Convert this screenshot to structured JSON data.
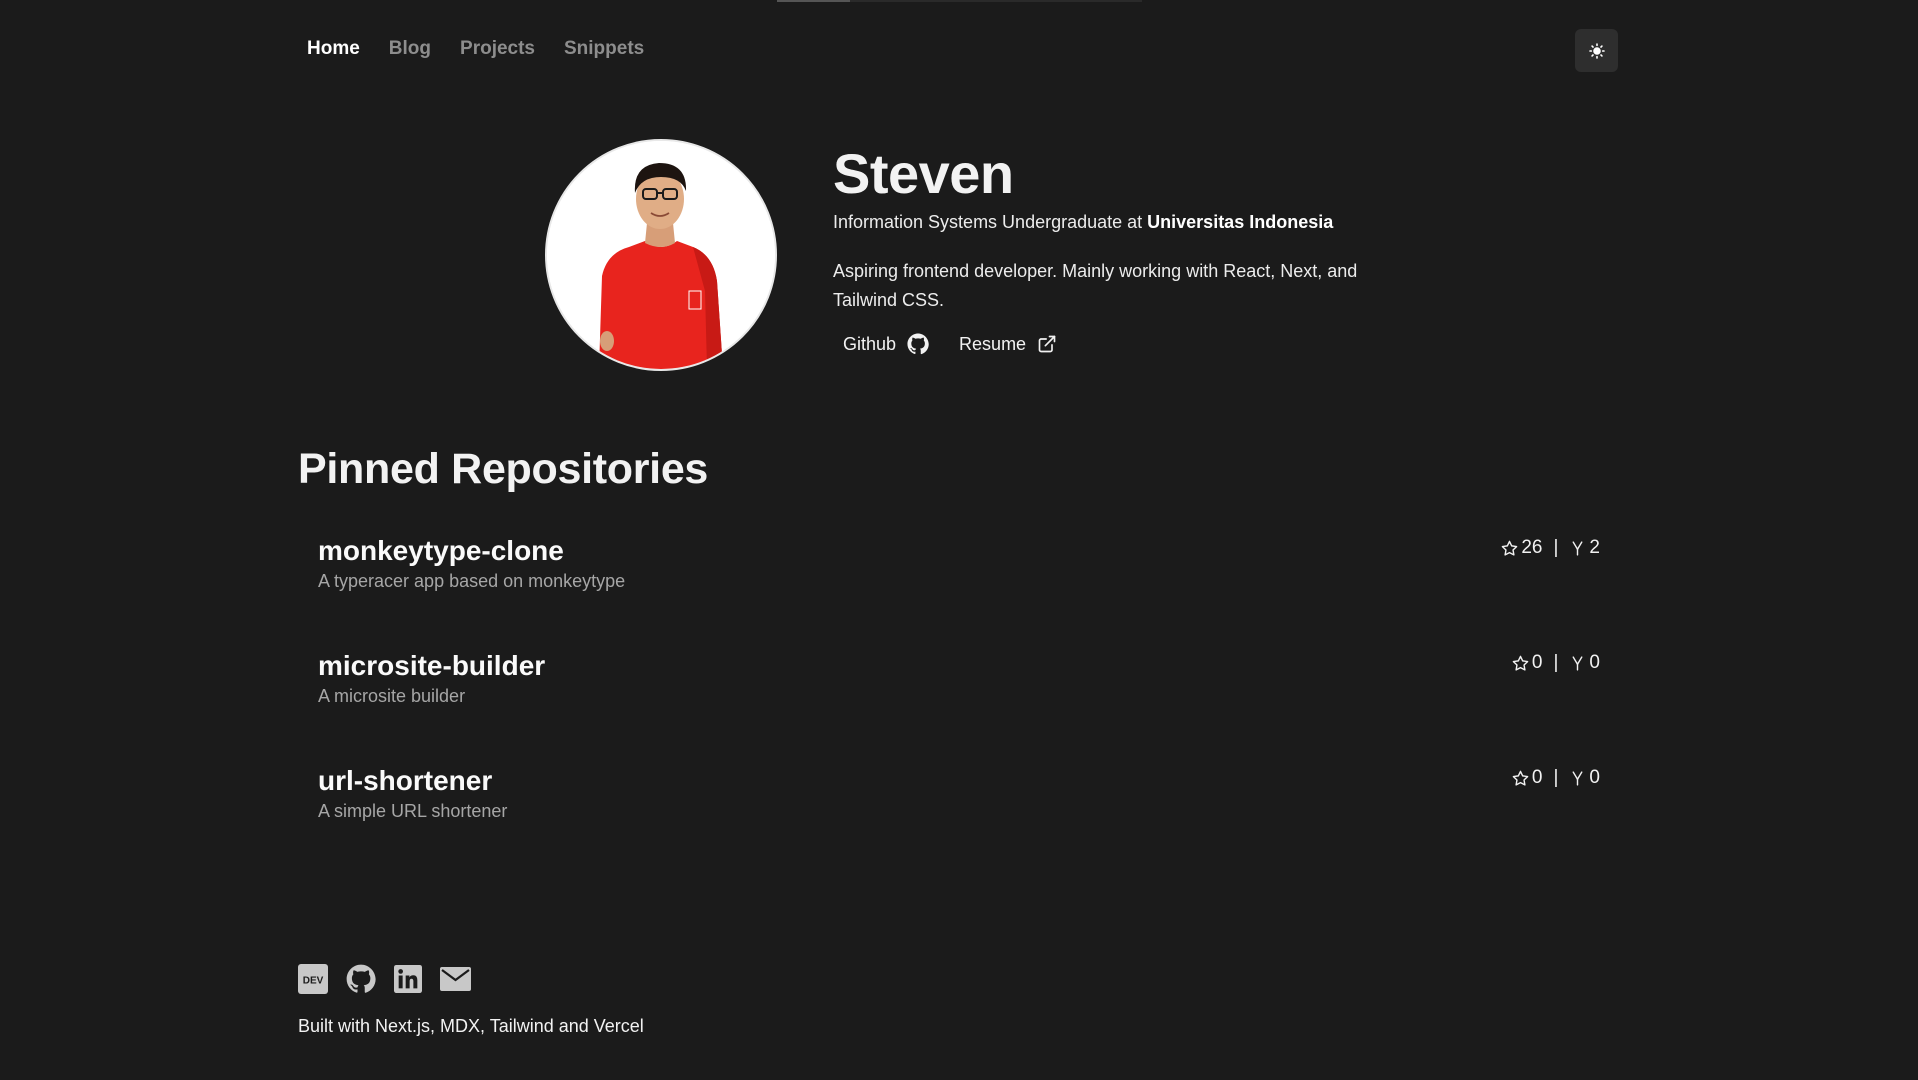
{
  "nav": {
    "items": [
      {
        "label": "Home",
        "active": true
      },
      {
        "label": "Blog",
        "active": false
      },
      {
        "label": "Projects",
        "active": false
      },
      {
        "label": "Snippets",
        "active": false
      }
    ],
    "theme_toggle_icon": "sun-icon"
  },
  "hero": {
    "name": "Steven",
    "role_prefix": "Information Systems Undergraduate at ",
    "role_org": "Universitas Indonesia",
    "bio": "Aspiring frontend developer. Mainly working with React, Next, and Tailwind CSS.",
    "links": {
      "github": "Github",
      "resume": "Resume"
    }
  },
  "pinned": {
    "title": "Pinned Repositories",
    "repos": [
      {
        "name": "monkeytype-clone",
        "description": "A typeracer app based on monkeytype",
        "stars": "26",
        "forks": "2"
      },
      {
        "name": "microsite-builder",
        "description": "A microsite builder",
        "stars": "0",
        "forks": "0"
      },
      {
        "name": "url-shortener",
        "description": "A simple URL shortener",
        "stars": "0",
        "forks": "0"
      }
    ],
    "separator": "|"
  },
  "footer": {
    "social_icons": [
      "dev-icon",
      "github-icon",
      "linkedin-icon",
      "mail-icon"
    ],
    "dev_badge": "DEV",
    "credit": "Built with Next.js, MDX, Tailwind and Vercel"
  },
  "colors": {
    "background": "#1b1b1b",
    "text": "#f2f2f2",
    "muted": "#8d8d8d",
    "shirt": "#e8241e"
  },
  "scroll_progress": 0.2
}
